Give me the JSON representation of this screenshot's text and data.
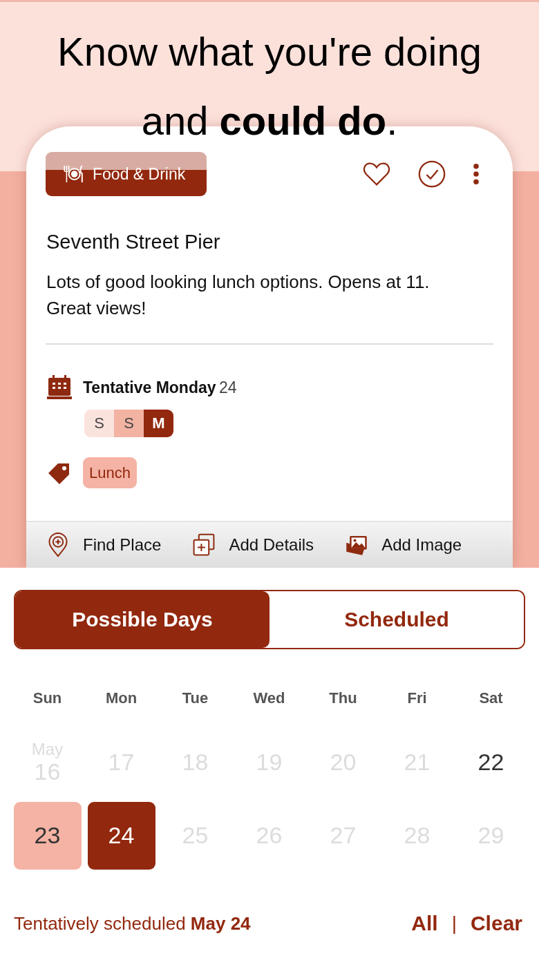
{
  "headline": "Know what you're doing and **could do**.",
  "card": {
    "category": "Food & Drink",
    "favorite": false,
    "done": false,
    "title": "Seventh Street Pier",
    "description": "Lots of good looking lunch options. Opens at 11. Great views!",
    "schedule": {
      "label": "Tentative Monday",
      "day": "24"
    },
    "week_strip": [
      {
        "label": "S",
        "tentative": false,
        "selected": false
      },
      {
        "label": "S",
        "tentative": true,
        "selected": false
      },
      {
        "label": "M",
        "tentative": false,
        "selected": true
      }
    ],
    "tags": [
      {
        "label": "Lunch"
      }
    ],
    "actions": [
      {
        "label": "Find Place",
        "kind": "place"
      },
      {
        "label": "Add Details",
        "kind": "details"
      },
      {
        "label": "Add Image",
        "kind": "image"
      }
    ]
  },
  "tabs": [
    {
      "label": "Possible Days",
      "selected": true
    },
    {
      "label": "Scheduled",
      "selected": false
    }
  ],
  "weekdays": [
    "Sun",
    "Mon",
    "Tue",
    "Wed",
    "Thu",
    "Fri",
    "Sat"
  ],
  "weeks": [
    [
      {
        "month": "May",
        "day": "16",
        "disabled": true,
        "tentative": false,
        "selected": false
      },
      {
        "day": "17",
        "disabled": true,
        "tentative": false,
        "selected": false
      },
      {
        "day": "18",
        "disabled": true,
        "tentative": false,
        "selected": false
      },
      {
        "day": "19",
        "disabled": true,
        "tentative": false,
        "selected": false
      },
      {
        "day": "20",
        "disabled": true,
        "tentative": false,
        "selected": false
      },
      {
        "day": "21",
        "disabled": true,
        "tentative": false,
        "selected": false
      },
      {
        "day": "22",
        "disabled": false,
        "tentative": false,
        "selected": false
      }
    ],
    [
      {
        "day": "23",
        "disabled": false,
        "tentative": true,
        "selected": false
      },
      {
        "day": "24",
        "disabled": false,
        "tentative": false,
        "selected": true
      },
      {
        "day": "25",
        "disabled": true,
        "tentative": false,
        "selected": false
      },
      {
        "day": "26",
        "disabled": true,
        "tentative": false,
        "selected": false
      },
      {
        "day": "27",
        "disabled": true,
        "tentative": false,
        "selected": false
      },
      {
        "day": "28",
        "disabled": true,
        "tentative": false,
        "selected": false
      },
      {
        "day": "29",
        "disabled": true,
        "tentative": false,
        "selected": false
      }
    ]
  ],
  "footer": {
    "summary": "Tentatively scheduled **May 24**",
    "all": "All",
    "separator": "|",
    "clear": "Clear"
  }
}
